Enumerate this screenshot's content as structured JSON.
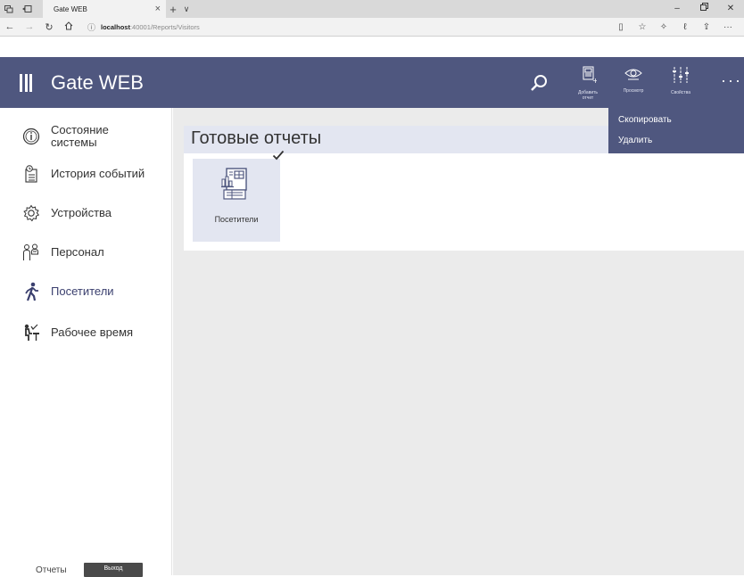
{
  "browser": {
    "tab_title": "Gate WEB",
    "tab_close": "×",
    "new_tab": "+",
    "tab_list": "∨",
    "url_host": "localhost",
    "url_rest": ":40001/Reports/Visitors"
  },
  "app": {
    "title": "Gate WEB",
    "header_buttons": {
      "add_report_line1": "Добавить",
      "add_report_line2": "отчет",
      "preview": "Просмотр",
      "properties": "Свойства",
      "more": "···"
    }
  },
  "sidebar": {
    "items": [
      {
        "label_line1": "Состояние",
        "label_line2": "системы",
        "icon": "info-circle-icon"
      },
      {
        "label_line1": "История событий",
        "label_line2": "",
        "icon": "history-log-icon"
      },
      {
        "label_line1": "Устройства",
        "label_line2": "",
        "icon": "gear-icon"
      },
      {
        "label_line1": "Персонал",
        "label_line2": "",
        "icon": "personnel-icon"
      },
      {
        "label_line1": "Посетители",
        "label_line2": "",
        "icon": "walking-person-icon"
      },
      {
        "label_line1": "Рабочее время",
        "label_line2": "",
        "icon": "work-time-icon"
      }
    ],
    "footer": {
      "reports": "Отчеты",
      "exit": "Выход"
    }
  },
  "main": {
    "page_title": "Готовые отчеты",
    "tiles": [
      {
        "label": "Посетители",
        "icon": "report-document-icon",
        "selected": true
      }
    ]
  },
  "context_menu": {
    "copy": "Скопировать",
    "delete": "Удалить"
  },
  "colors": {
    "accent": "#4f577f",
    "tile_bg": "#e3e6f1",
    "content_bg": "#ebebeb"
  }
}
